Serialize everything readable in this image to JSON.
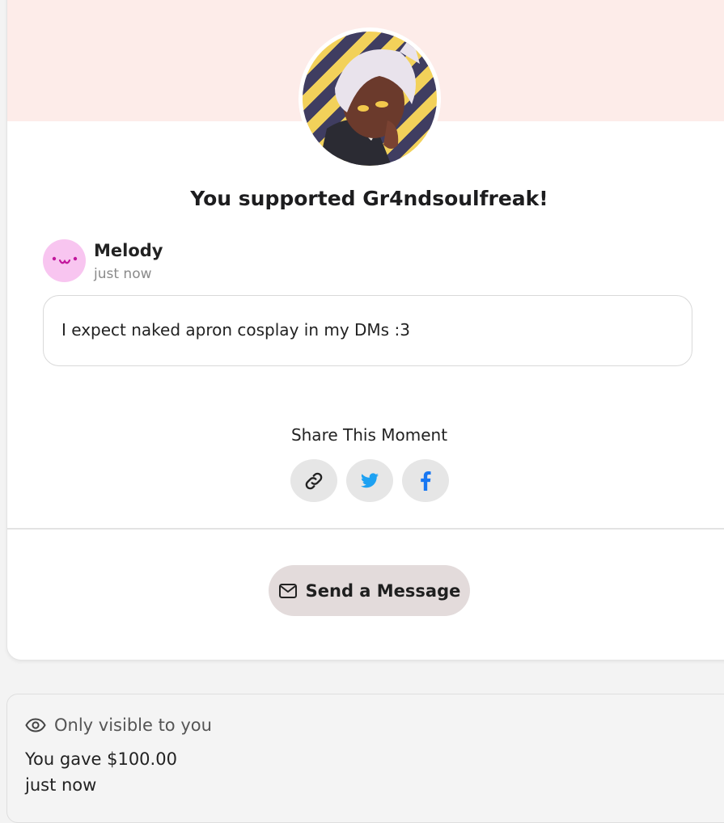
{
  "title": "You supported Gr4ndsoulfreak!",
  "supporter": {
    "name": "Melody",
    "time": "just now",
    "message": "I expect naked apron cosplay in my DMs :3"
  },
  "share": {
    "label": "Share This Moment",
    "buttons": [
      "link-icon",
      "twitter-icon",
      "facebook-icon"
    ]
  },
  "send_message": {
    "label": "Send a Message",
    "icon": "envelope-icon"
  },
  "private": {
    "visibility_label": "Only visible to you",
    "icon": "eye-icon",
    "gave_text": "You gave $100.00",
    "time": "just now"
  },
  "colors": {
    "banner": "#fdece9",
    "supporter_avatar": "#f8c5f0",
    "twitter": "#1da1f2",
    "facebook": "#1877f2",
    "send_button": "#e3dbdb"
  }
}
